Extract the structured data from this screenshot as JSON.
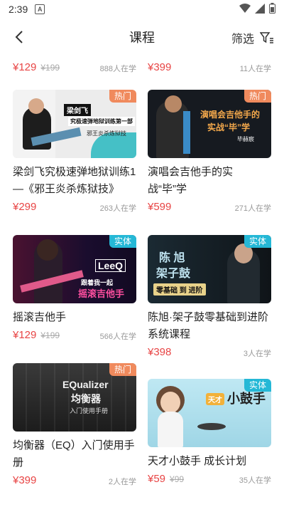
{
  "status": {
    "time": "2:39",
    "notif": "A"
  },
  "header": {
    "title": "课程",
    "filter_label": "筛选"
  },
  "top_row": [
    {
      "price": "¥129",
      "orig": "¥199",
      "count": "888人在学"
    },
    {
      "price": "¥399",
      "orig": "",
      "count": "11人在学"
    }
  ],
  "cards": [
    {
      "badge": "热门",
      "title": "梁剑飞究极速弹地狱训练1—《邪王炎杀炼狱技》",
      "price": "¥299",
      "orig": "",
      "count": "263人在学",
      "thumb_lines": [
        "梁剑飞",
        "究极速弹地狱训练第一部",
        "邪王炎杀炼狱技"
      ]
    },
    {
      "badge": "热门",
      "title": "演唱会吉他手的实战“毕”学",
      "price": "¥599",
      "orig": "",
      "count": "271人在学",
      "thumb_lines": [
        "演唱会吉他手的",
        "实战“毕”学",
        "毕赫宸"
      ]
    },
    {
      "badge": "实体",
      "title": "摇滚吉他手",
      "price": "¥129",
      "orig": "¥199",
      "count": "566人在学",
      "thumb_lines": [
        "LeeQ",
        "跟着我一起",
        "摇滚吉他手"
      ]
    },
    {
      "badge": "实体",
      "title": "陈旭·架子鼓零基础到进阶系统课程",
      "price": "¥398",
      "orig": "",
      "count": "3人在学",
      "thumb_lines": [
        "陈  旭",
        "架子鼓",
        "零基础 到 进阶"
      ]
    },
    {
      "badge": "热门",
      "title": "均衡器（EQ）入门使用手册",
      "price": "¥399",
      "orig": "",
      "count": "2人在学",
      "thumb_lines": [
        "EQualizer",
        "均衡器",
        "入门使用手册"
      ]
    },
    {
      "badge": "实体",
      "title": "天才小鼓手 成长计划",
      "price": "¥59",
      "orig": "¥99",
      "count": "35人在学",
      "thumb_lines": [
        "天才",
        "小鼓手"
      ]
    }
  ],
  "colors": {
    "price": "#e84545",
    "hot_badge": "#f08a5d",
    "real_badge": "#25b8d6"
  }
}
